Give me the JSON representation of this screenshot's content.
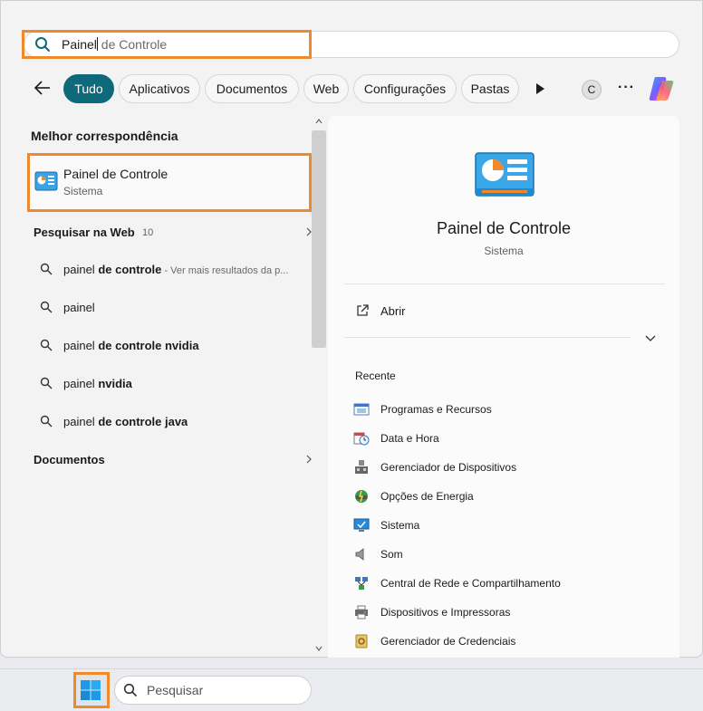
{
  "search": {
    "typed": "Painel",
    "suggestion": " de Controle"
  },
  "filters": [
    "Tudo",
    "Aplicativos",
    "Documentos",
    "Web",
    "Configurações",
    "Pastas"
  ],
  "account_initial": "C",
  "more_label": "···",
  "best_match": {
    "header": "Melhor correspondência",
    "title": "Painel de Controle",
    "subtitle": "Sistema"
  },
  "web": {
    "header": "Pesquisar na Web",
    "count": "10",
    "results": [
      {
        "normal": "painel ",
        "bold": "de controle",
        "hint": " - Ver mais resultados da p..."
      },
      {
        "normal": "painel",
        "bold": "",
        "hint": ""
      },
      {
        "normal": "painel ",
        "bold": "de controle nvidia",
        "hint": ""
      },
      {
        "normal": "painel ",
        "bold": "nvidia",
        "hint": ""
      },
      {
        "normal": "painel ",
        "bold": "de controle java",
        "hint": ""
      }
    ]
  },
  "documents_header": "Documentos",
  "detail": {
    "title": "Painel de Controle",
    "subtitle": "Sistema",
    "open_label": "Abrir",
    "recent_label": "Recente",
    "recent": [
      {
        "label": "Programas e Recursos",
        "icon": "programs-features-icon"
      },
      {
        "label": "Data e Hora",
        "icon": "date-time-icon"
      },
      {
        "label": "Gerenciador de Dispositivos",
        "icon": "device-manager-icon"
      },
      {
        "label": "Opções de Energia",
        "icon": "power-options-icon"
      },
      {
        "label": "Sistema",
        "icon": "system-icon"
      },
      {
        "label": "Som",
        "icon": "sound-icon"
      },
      {
        "label": "Central de Rede e Compartilhamento",
        "icon": "network-center-icon"
      },
      {
        "label": "Dispositivos e Impressoras",
        "icon": "devices-printers-icon"
      },
      {
        "label": "Gerenciador de Credenciais",
        "icon": "credential-manager-icon"
      }
    ]
  },
  "taskbar": {
    "search_placeholder": "Pesquisar"
  },
  "colors": {
    "accent": "#0e6a7a",
    "highlight": "#f0882c"
  }
}
